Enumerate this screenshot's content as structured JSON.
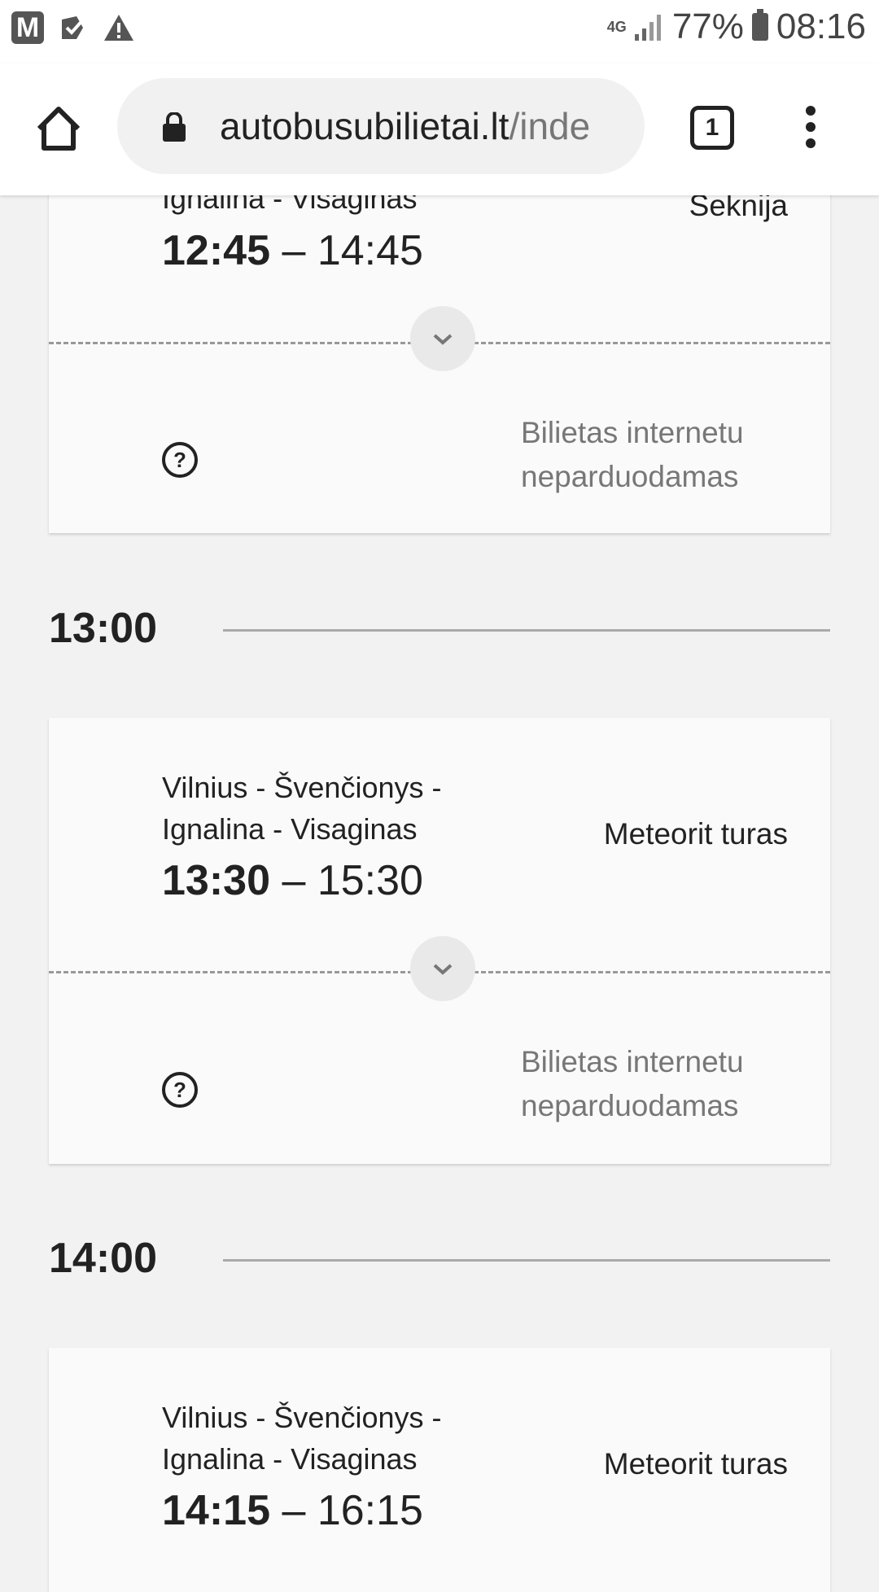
{
  "status_bar": {
    "m_icon": "M",
    "network": "4G",
    "battery": "77%",
    "time": "08:16"
  },
  "browser": {
    "url_domain": "autobusubilietai.lt",
    "url_rest": "/inde",
    "tab_count": "1"
  },
  "trips": [
    {
      "route": "Ignalina - Visaginas",
      "operator": "Seknija",
      "departure": "12:45",
      "dash": "–",
      "arrival": "14:45",
      "status": "Bilietas internetu neparduodamas"
    },
    {
      "route": "Vilnius - Švenčionys - Ignalina - Visaginas",
      "operator": "Meteorit turas",
      "departure": "13:30",
      "dash": "–",
      "arrival": "15:30",
      "status": "Bilietas internetu neparduodamas"
    },
    {
      "route": "Vilnius - Švenčionys - Ignalina - Visaginas",
      "operator": "Meteorit turas",
      "departure": "14:15",
      "dash": "–",
      "arrival": "16:15"
    }
  ],
  "hours": [
    "13:00",
    "14:00"
  ],
  "icons": {
    "home": "home-icon",
    "lock": "lock-icon",
    "menu": "more-vert-icon",
    "expand": "chevron-down-icon",
    "help": "question-circle-icon"
  }
}
